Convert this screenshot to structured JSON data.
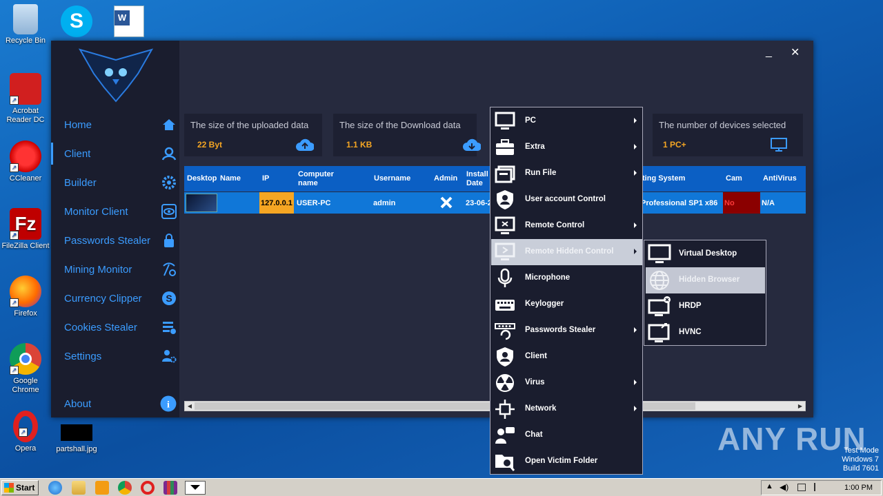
{
  "desktop": {
    "icons": [
      {
        "label": "Recycle Bin"
      },
      {
        "label": "Acrobat Reader DC"
      },
      {
        "label": "CCleaner"
      },
      {
        "label": "FileZilla Client"
      },
      {
        "label": "Firefox"
      },
      {
        "label": "Google Chrome"
      },
      {
        "label": "Opera"
      },
      {
        "label": "partshall.jpg"
      }
    ],
    "watermark": "ANY RUN",
    "test_mode": [
      "Test Mode",
      "Windows 7",
      "Build 7601"
    ]
  },
  "app": {
    "nav": [
      {
        "label": "Home",
        "icon": "home-icon"
      },
      {
        "label": "Client",
        "icon": "user-icon"
      },
      {
        "label": "Builder",
        "icon": "gear-icon"
      },
      {
        "label": "Monitor Client",
        "icon": "eye-icon"
      },
      {
        "label": "Passwords Stealer",
        "icon": "lock-icon"
      },
      {
        "label": "Mining Monitor",
        "icon": "pickaxe-icon"
      },
      {
        "label": "Currency Clipper",
        "icon": "dollar-icon"
      },
      {
        "label": "Cookies Stealer",
        "icon": "cookie-list-icon"
      },
      {
        "label": "Settings",
        "icon": "user-settings-icon"
      },
      {
        "label": "About",
        "icon": "info-icon"
      }
    ],
    "window_controls": {
      "minimize": "_",
      "close": "✕"
    },
    "cards": [
      {
        "title": "The size of the uploaded data",
        "value": "22 Byt",
        "icon": "cloud-upload-icon"
      },
      {
        "title": "The size of the Download data",
        "value": "1.1 KB",
        "icon": "cloud-download-icon"
      },
      {
        "title": "The number of devices selected",
        "value": "1 PC+",
        "icon": "monitor-icon"
      }
    ],
    "table": {
      "headers": [
        "Desktop",
        "Name",
        "IP",
        "Computer name",
        "Username",
        "Admin",
        "Install Date",
        "ting System",
        "Cam",
        "AntiVirus"
      ],
      "row": {
        "ip": "127.0.0.1",
        "computer": "USER-PC",
        "username": "admin",
        "install_date": "23-06-2",
        "os": "Professional SP1 x86",
        "cam": "No",
        "antivirus": "N/A"
      }
    }
  },
  "context_menu": {
    "items": [
      {
        "label": "PC",
        "icon": "monitor-icon",
        "submenu": true
      },
      {
        "label": "Extra",
        "icon": "toolbox-icon",
        "submenu": true
      },
      {
        "label": "Run File",
        "icon": "run-file-icon",
        "submenu": true
      },
      {
        "label": "User account Control",
        "icon": "shield-user-icon",
        "submenu": false
      },
      {
        "label": "Remote Control",
        "icon": "remote-control-icon",
        "submenu": true
      },
      {
        "label": "Remote Hidden Control",
        "icon": "remote-hidden-icon",
        "submenu": true
      },
      {
        "label": "Microphone",
        "icon": "microphone-icon",
        "submenu": false
      },
      {
        "label": "Keylogger",
        "icon": "keyboard-icon",
        "submenu": false
      },
      {
        "label": "Passwords Stealer",
        "icon": "password-icon",
        "submenu": true
      },
      {
        "label": "Client",
        "icon": "shield-client-icon",
        "submenu": false
      },
      {
        "label": "Virus",
        "icon": "radiation-icon",
        "submenu": true
      },
      {
        "label": "Network",
        "icon": "network-icon",
        "submenu": true
      },
      {
        "label": "Chat",
        "icon": "chat-icon",
        "submenu": false
      },
      {
        "label": "Open Victim Folder",
        "icon": "folder-search-icon",
        "submenu": false
      }
    ],
    "highlighted": "Remote Hidden Control"
  },
  "submenu": {
    "items": [
      {
        "label": "Virtual Desktop",
        "icon": "monitor-icon"
      },
      {
        "label": "Hidden Browser",
        "icon": "globe-icon"
      },
      {
        "label": "HRDP",
        "icon": "hrdp-icon"
      },
      {
        "label": "HVNC",
        "icon": "hvnc-icon"
      }
    ],
    "highlighted": "Hidden Browser"
  },
  "taskbar": {
    "start_label": "Start",
    "clock": "1:00 PM"
  }
}
